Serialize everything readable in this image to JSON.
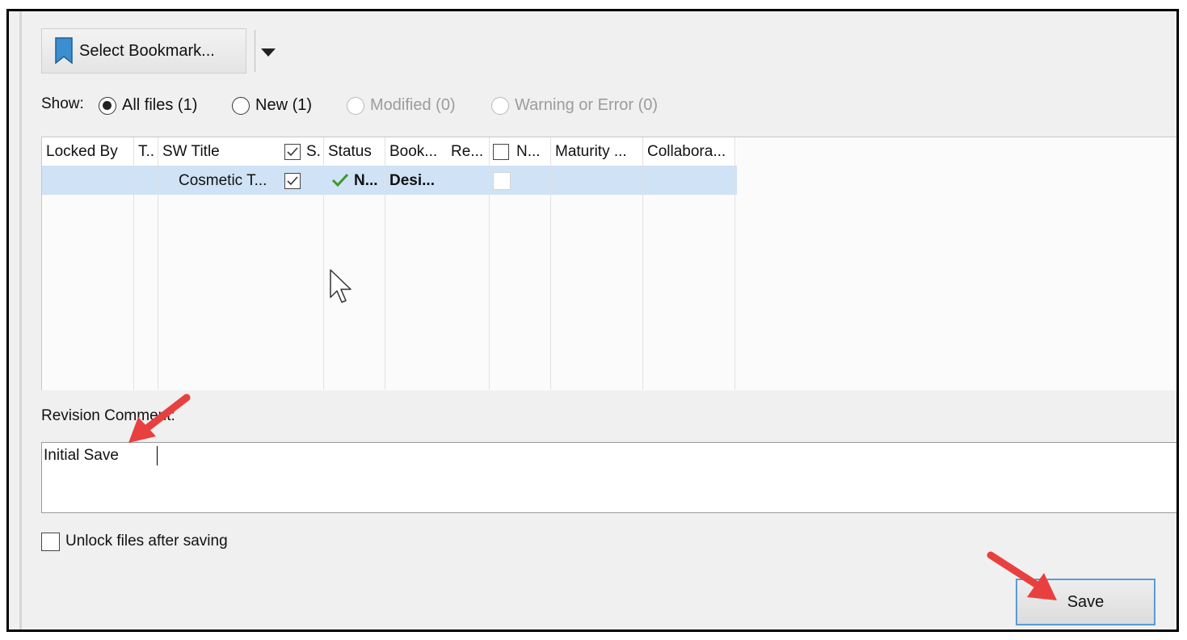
{
  "toolbar": {
    "select_bookmark_label": "Select Bookmark..."
  },
  "show": {
    "label": "Show:",
    "options": [
      {
        "label": "All files (1)",
        "selected": true,
        "enabled": true
      },
      {
        "label": "New (1)",
        "selected": false,
        "enabled": true
      },
      {
        "label": "Modified (0)",
        "selected": false,
        "enabled": false
      },
      {
        "label": "Warning or Error (0)",
        "selected": false,
        "enabled": false
      }
    ]
  },
  "grid": {
    "headers": [
      "Locked By",
      "T..",
      "SW Title",
      "S.",
      "Status",
      "Book...",
      "Re...",
      "N...",
      "Maturity ...",
      "Collabora..."
    ],
    "rows": [
      {
        "sw_title": "Cosmetic T...",
        "status": "N...",
        "bookmark": "Desi..."
      }
    ]
  },
  "revision": {
    "label": "Revision Comment:",
    "value": "Initial Save"
  },
  "unlock": {
    "label": "Unlock files after saving"
  },
  "save_label": "Save",
  "colors": {
    "selection_row": "#cfe2f6",
    "annotation_arrow": "#e8403f",
    "check_green": "#3a9a2c",
    "save_border": "#5a9bd5"
  }
}
